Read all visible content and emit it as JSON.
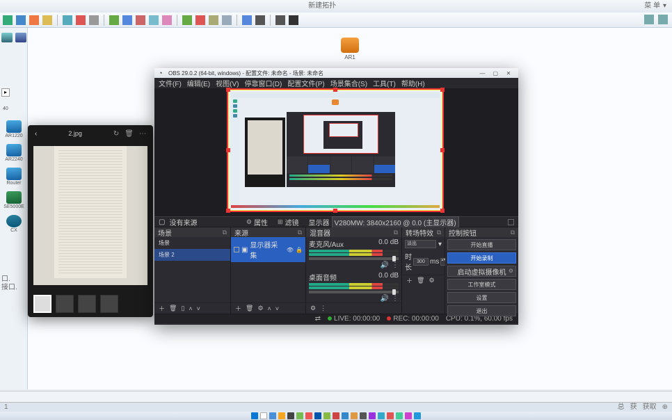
{
  "main": {
    "title": "新建拓扑",
    "right_btn1": "菜 单",
    "right_chev": "▾"
  },
  "device_labels": {
    "hdr": "40",
    "d1": "AR1220",
    "d2": "AR2240",
    "d3": "Router",
    "d4": "SE5000E",
    "d5": "CX"
  },
  "left_footer": {
    "l1": "口.",
    "l2": "接口."
  },
  "canvas": {
    "router": "AR1"
  },
  "imgviewer": {
    "filename": "2.jpg",
    "icon_rotate": "↻",
    "icon_del": "🗑",
    "icon_more": "⋯"
  },
  "obs": {
    "title": "OBS 29.0.2 (64-bit, windows) - 配置文件: 未命名 - 场景: 未命名",
    "menu": {
      "file": "文件(F)",
      "edit": "编辑(E)",
      "view": "视图(V)",
      "dock": "停靠窗口(D)",
      "profile": "配置文件(P)",
      "scenes": "场景集合(S)",
      "tools": "工具(T)",
      "help": "帮助(H)"
    },
    "toolbar": {
      "nosource": "没有来源",
      "prop": "属性",
      "filter": "滤镜",
      "canvas_label": "显示器",
      "canvas_value": "V280MW: 3840x2160 @ 0.0 (主显示器)"
    },
    "docks": {
      "scenes": "场景",
      "sources": "来源",
      "mixer": "混音器",
      "trans": "转场特效",
      "controls": "控制按钮"
    },
    "scenes": {
      "s1": "场景",
      "s2": "场景 2"
    },
    "sources": {
      "src1": "显示器采集"
    },
    "mixer": {
      "track1": "麦克风/Aux",
      "track2": "桌面音频",
      "db": "0.0 dB"
    },
    "trans": {
      "type": "淡出",
      "dur_label": "时长",
      "dur_val": "300",
      "dur_unit": "ms"
    },
    "controls": {
      "stream": "开始直播",
      "record": "开始录制",
      "vcam": "启动虚拟摄像机",
      "studio": "工作室模式",
      "settings": "设置",
      "exit": "退出"
    },
    "status": {
      "live": "LIVE: 00:00:00",
      "rec": "REC: 00:00:00",
      "cpu": "CPU: 0.1%, 60.00 fps"
    }
  },
  "bottom_status": {
    "left": "1",
    "r1": "总",
    "r2": "获",
    "r3": "获取",
    "r4": "⊕"
  }
}
